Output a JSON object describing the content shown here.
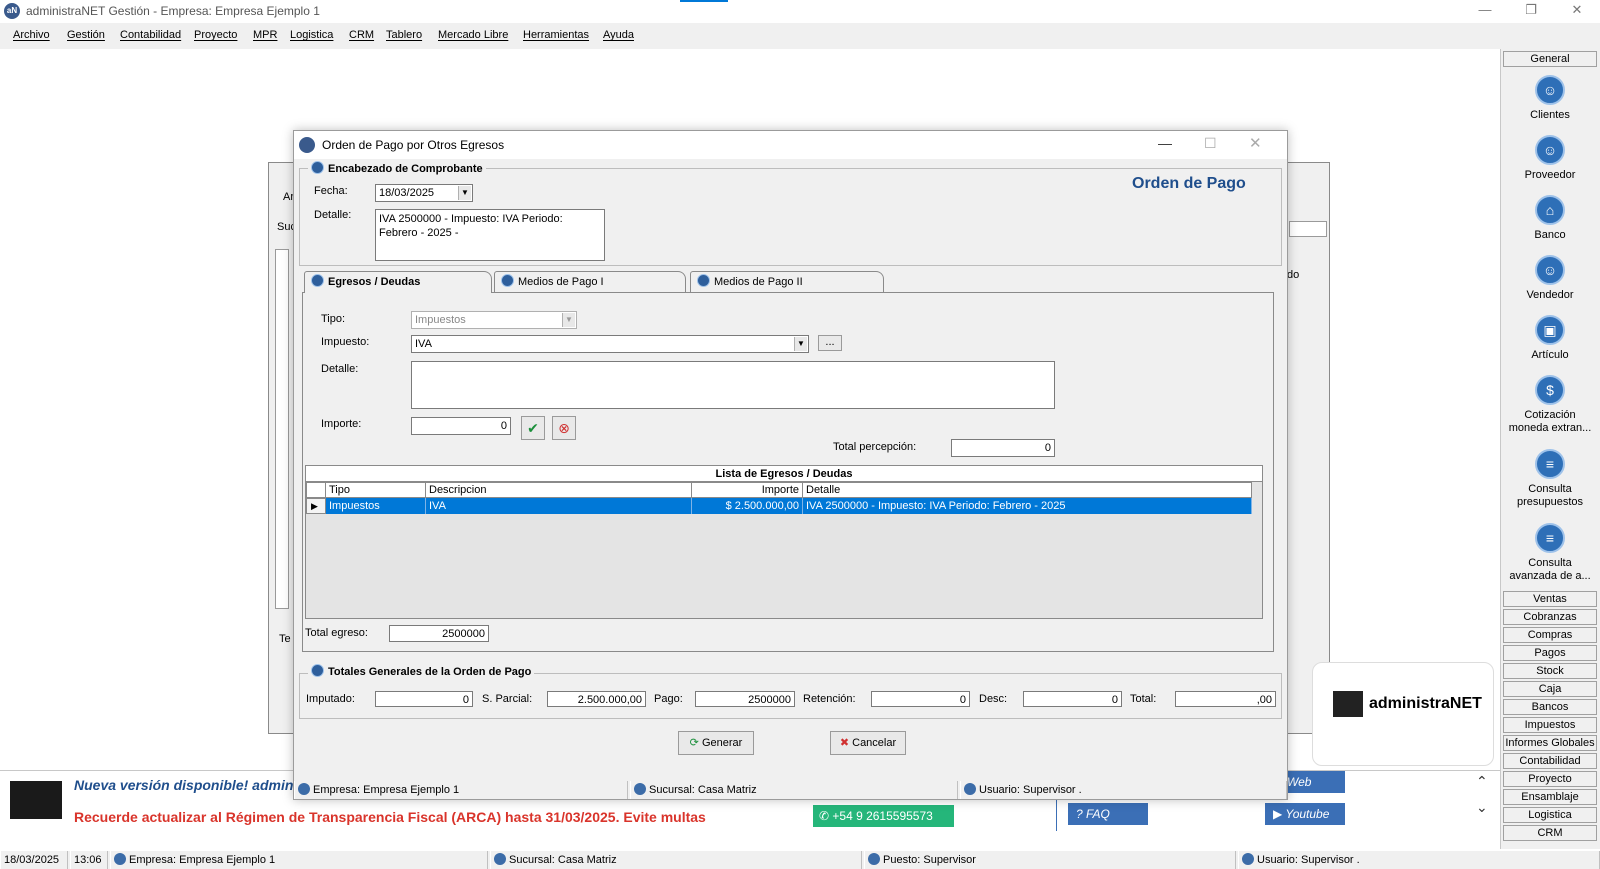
{
  "app": {
    "title": "administraNET Gestión - Empresa: Empresa Ejemplo 1",
    "logo_text": "administraNET"
  },
  "menu": [
    "Archivo",
    "Gestión",
    "Contabilidad",
    "Proyecto",
    "MPR",
    "Logistica",
    "CRM",
    "Tablero",
    "Mercado Libre",
    "Herramientas",
    "Ayuda"
  ],
  "sidebar": {
    "top_button": "General",
    "items": [
      {
        "label": "Clientes",
        "icon": "clients-icon"
      },
      {
        "label": "Proveedor",
        "icon": "supplier-icon"
      },
      {
        "label": "Banco",
        "icon": "bank-icon"
      },
      {
        "label": "Vendedor",
        "icon": "seller-icon"
      },
      {
        "label": "Artículo",
        "icon": "article-icon"
      },
      {
        "label": "Cotización moneda extran...",
        "icon": "currency-icon"
      },
      {
        "label": "Consulta presupuestos",
        "icon": "budget-icon"
      },
      {
        "label": "Consulta avanzada de a...",
        "icon": "advanced-query-icon"
      }
    ],
    "sections": [
      "Ventas",
      "Cobranzas",
      "Compras",
      "Pagos",
      "Stock",
      "Caja",
      "Bancos",
      "Impuestos",
      "Informes Globales",
      "Contabilidad",
      "Proyecto",
      "Ensamblaje",
      "Logistica",
      "CRM"
    ]
  },
  "dialog": {
    "title": "Orden de Pago por Otros Egresos",
    "header_group": "Encabezado de Comprobante",
    "doc_title": "Orden de Pago",
    "fecha_label": "Fecha:",
    "fecha_value": "18/03/2025",
    "detalle_label": "Detalle:",
    "detalle_value": "IVA 2500000 - Impuesto: IVA Periodo: Febrero - 2025 -",
    "tabs": [
      "Egresos / Deudas",
      "Medios de Pago I",
      "Medios de Pago II"
    ],
    "tipo_label": "Tipo:",
    "tipo_value": "Impuestos",
    "impuesto_label": "Impuesto:",
    "impuesto_value": "IVA",
    "ellipsis_button": "...",
    "detalle2_label": "Detalle:",
    "detalle2_value": "",
    "importe_label": "Importe:",
    "importe_value": "0",
    "total_percepcion_label": "Total percepción:",
    "total_percepcion_value": "0",
    "grid": {
      "title": "Lista de Egresos / Deudas",
      "columns": [
        "Tipo",
        "Descripcion",
        "Importe",
        "Detalle"
      ],
      "rows": [
        {
          "tipo": "Impuestos",
          "descripcion": "IVA",
          "importe": "$ 2.500.000,00",
          "detalle": "IVA 2500000 - Impuesto: IVA Periodo: Febrero - 2025"
        }
      ]
    },
    "total_egreso_label": "Total egreso:",
    "total_egreso_value": "2500000",
    "totals_group": "Totales Generales de la Orden de Pago",
    "imputado_label": "Imputado:",
    "imputado_value": "0",
    "sparcial_label": "S. Parcial:",
    "sparcial_value": "2.500.000,00",
    "pago_label": "Pago:",
    "pago_value": "2500000",
    "retencion_label": "Retención:",
    "retencion_value": "0",
    "desc_label": "Desc:",
    "desc_value": "0",
    "total_label": "Total:",
    "total_value": ",00",
    "generar_button": "Generar",
    "cancelar_button": "Cancelar",
    "status": {
      "empresa": "Empresa: Empresa Ejemplo 1",
      "sucursal": "Sucursal: Casa Matriz",
      "usuario": "Usuario: Supervisor ."
    }
  },
  "bg_window": {
    "fragments": [
      "Ar",
      "Suc",
      "Te",
      "do"
    ]
  },
  "banner": {
    "new_version": "Nueva versión disponible! admin",
    "warning": "Recuerde actualizar al Régimen de Transparencia Fiscal (ARCA) hasta 31/03/2025. Evite multas",
    "whatsapp": "+54 9 2615595573",
    "web": "Web",
    "faq": "FAQ",
    "youtube": "Youtube",
    "logo_partial": "aNET"
  },
  "statusbar": {
    "date": "18/03/2025",
    "time": "13:06",
    "empresa": "Empresa: Empresa Ejemplo 1",
    "sucursal": "Sucursal: Casa Matriz",
    "puesto": "Puesto: Supervisor",
    "usuario": "Usuario: Supervisor ."
  },
  "colors": {
    "accent_blue": "#0078d7",
    "title_blue": "#1f4e8c",
    "banner_red": "#d9342b",
    "whatsapp_green": "#25b67a",
    "link_blue": "#3b6fb6"
  }
}
